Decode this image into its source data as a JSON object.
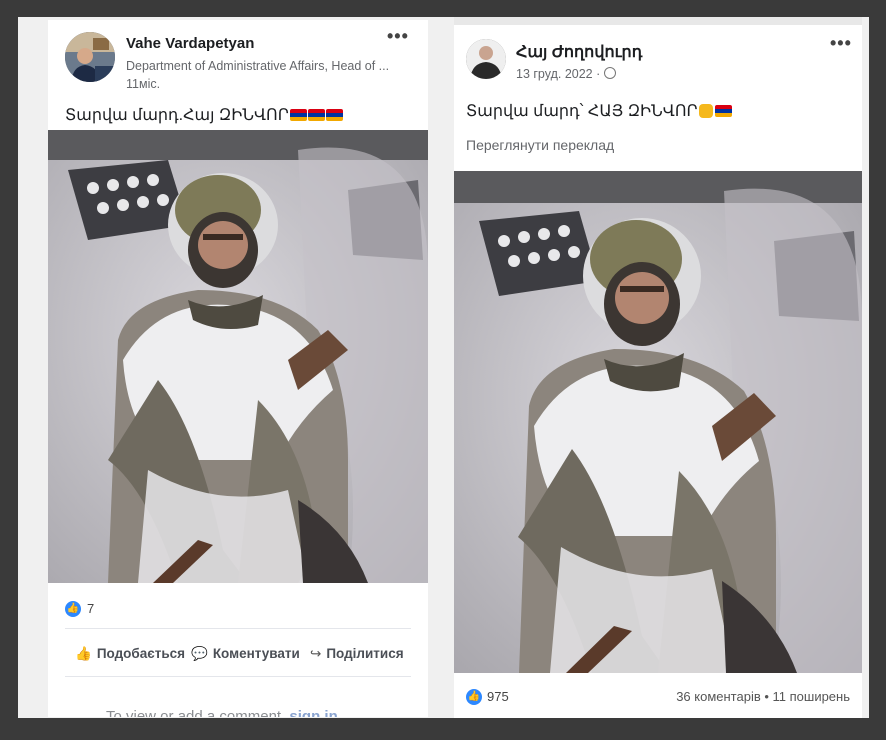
{
  "left_post": {
    "author": "Vahe Vardapetyan",
    "subtitle": "Department of Administrative Affairs, Head of ...",
    "time": "11міс.",
    "text": "Տարվա մարդ.Հայ ԶԻՆՎՈՐ",
    "likes": "7",
    "actions": {
      "like": "Подобається",
      "comment": "Коментувати",
      "share": "Поділитися"
    },
    "comment_prompt": "To view or add a comment, ",
    "comment_link": "sign in",
    "more_icon": "more-options-icon"
  },
  "right_post": {
    "author": "Հայ Ժողովուրդ",
    "time": "13 груд. 2022 ·",
    "text": "Տարվա մարդ՝ ՀԱՅ ԶԻՆՎՈՐ",
    "translate": "Переглянути переклад",
    "likes": "975",
    "stats": "36 коментарів • 11 поширень"
  }
}
